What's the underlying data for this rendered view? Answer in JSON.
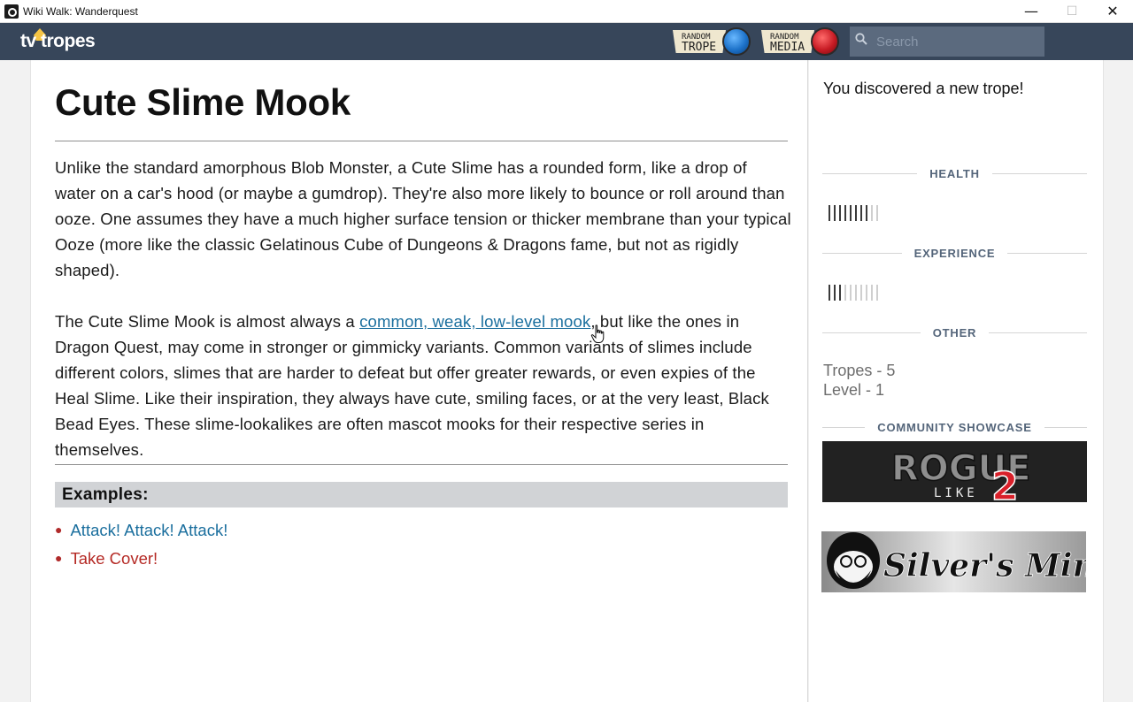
{
  "window": {
    "title": "Wiki Walk: Wanderquest",
    "minimize_glyph": "—",
    "maximize_glyph": "☐",
    "close_glyph": "✕"
  },
  "navbar": {
    "logo": "tv tropes",
    "random_trope": {
      "small": "RANDOM",
      "big": "TROPE"
    },
    "random_media": {
      "small": "RANDOM",
      "big": "MEDIA"
    },
    "search_placeholder": "Search"
  },
  "article": {
    "title": "Cute Slime Mook",
    "paragraph1": "Unlike the standard amorphous Blob Monster, a Cute Slime has a rounded form, like a drop of water on a car's hood (or maybe a gumdrop). They're also more likely to bounce or roll around than ooze. One assumes they have a much higher surface tension or thicker membrane than your typical Ooze (more like the classic Gelatinous Cube of Dungeons & Dragons fame, but not as rigidly shaped).",
    "paragraph2_before": "The Cute Slime Mook is almost always a ",
    "paragraph2_link": "common, weak, low-level mook",
    "paragraph2_after": ", but like the ones in Dragon Quest, may come in stronger or gimmicky variants. Common variants of slimes include different colors, slimes that are harder to defeat but offer greater rewards, or even expies of the Heal Slime. Like their inspiration, they always have cute, smiling faces, or at the very least, Black Bead Eyes. These slime-lookalikes are often mascot mooks for their respective series in themselves.",
    "examples_heading": "Examples:",
    "examples": [
      {
        "label": "Attack! Attack! Attack!",
        "color": "#1b6f9e"
      },
      {
        "label": "Take Cover!",
        "color": "#b52a25"
      }
    ]
  },
  "sidebar": {
    "discover_text": "You discovered a new trope!",
    "health_heading": "HEALTH",
    "health_fraction": 0.8,
    "experience_heading": "EXPERIENCE",
    "experience_fraction": 0.3,
    "other_heading": "OTHER",
    "tropes_stat": "Tropes - 5",
    "level_stat": "Level - 1",
    "community_heading": "COMMUNITY SHOWCASE",
    "showcase": [
      {
        "title_main": "ROGUE",
        "title_sub": "LIKE",
        "title_num": "2"
      },
      {
        "title": "Silver's Mind"
      }
    ]
  },
  "colors": {
    "navbar": "#37465a",
    "link": "#1b6f9e",
    "red_link": "#b52a25",
    "section_heading": "#54657a"
  }
}
